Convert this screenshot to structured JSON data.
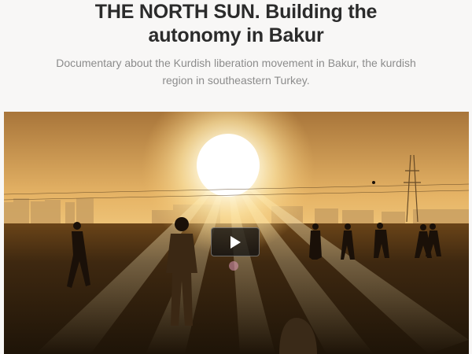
{
  "header": {
    "title": "THE NORTH SUN. Building the autonomy in Bakur",
    "subtitle": "Documentary about the Kurdish liberation movement in Bakur, the kurdish region in southeastern Turkey."
  },
  "video": {
    "play_icon": "play-icon",
    "colors": {
      "sky_top": "#b07a3c",
      "sky_mid": "#f2c777",
      "sun": "#ffffff",
      "horizon": "#fde9b0",
      "ground": "#2b1c0c"
    }
  }
}
